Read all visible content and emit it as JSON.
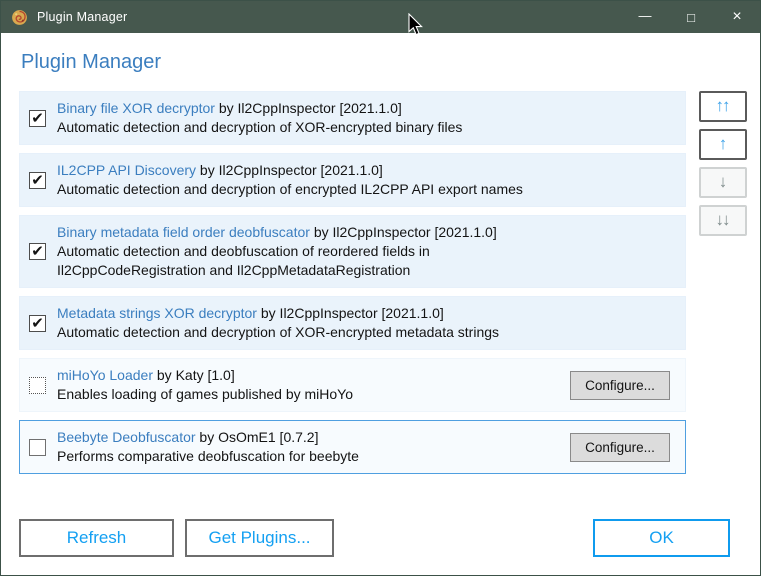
{
  "window": {
    "title": "Plugin Manager"
  },
  "header": {
    "title": "Plugin Manager"
  },
  "plugins": [
    {
      "name": "Binary file XOR decryptor",
      "byline": "by Il2CppInspector [2021.1.0]",
      "description": "Automatic detection and decryption of XOR-encrypted binary files",
      "checkbox_state": "checked"
    },
    {
      "name": "IL2CPP API Discovery",
      "byline": "by Il2CppInspector [2021.1.0]",
      "description": "Automatic detection and decryption of encrypted IL2CPP API export names",
      "checkbox_state": "checked"
    },
    {
      "name": "Binary metadata field order deobfuscator",
      "byline": "by Il2CppInspector [2021.1.0]",
      "description": "Automatic detection and deobfuscation of reordered fields in\nIl2CppCodeRegistration and Il2CppMetadataRegistration",
      "checkbox_state": "checked"
    },
    {
      "name": "Metadata strings XOR decryptor",
      "byline": "by Il2CppInspector [2021.1.0]",
      "description": "Automatic detection and decryption of XOR-encrypted metadata strings",
      "checkbox_state": "checked"
    },
    {
      "name": "miHoYo Loader",
      "byline": "by Katy [1.0]",
      "description": "Enables loading of games published by miHoYo",
      "checkbox_state": "dotted",
      "configure_label": "Configure..."
    },
    {
      "name": "Beebyte Deobfuscator",
      "byline": "by OsOmE1 [0.7.2]",
      "description": "Performs comparative deobfuscation for beebyte",
      "checkbox_state": "unchecked",
      "selected": true,
      "configure_label": "Configure..."
    }
  ],
  "glyphs": {
    "check": "✔",
    "minimize": "—",
    "maximize": "□",
    "close": "×",
    "move_top": "↑↑",
    "move_up": "↑",
    "move_down": "↓",
    "move_bottom": "↓↓"
  },
  "footer": {
    "refresh": "Refresh",
    "get_plugins": "Get Plugins...",
    "ok": "OK"
  },
  "colors": {
    "titlebar": "#46584e",
    "link_blue": "#3b7ebf",
    "bright_blue": "#14a0f2",
    "ok_border": "#0f9bee",
    "row_bg": "#eaf3fb",
    "row_bg_pale": "#f7fbfe",
    "selected_border": "#4f9fe0"
  }
}
